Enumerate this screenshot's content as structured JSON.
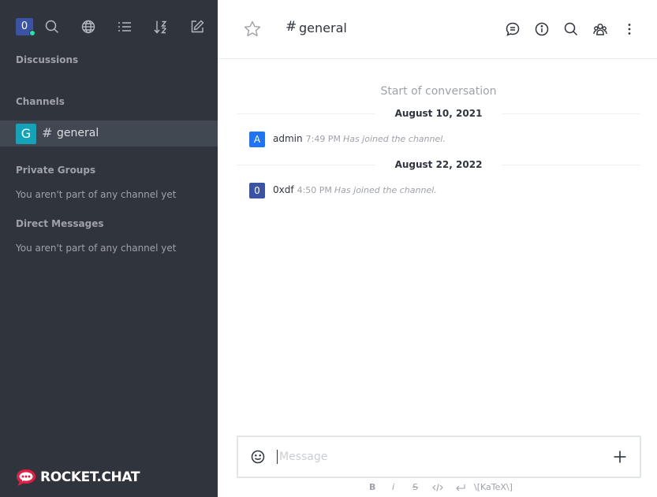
{
  "sidebar": {
    "user_avatar": "0",
    "toolbar": [
      "search-icon",
      "globe-icon",
      "list-icon",
      "sort-icon",
      "edit-icon"
    ],
    "sections": {
      "discussions": "Discussions",
      "channels": "Channels",
      "private_groups": "Private Groups",
      "direct_messages": "Direct Messages"
    },
    "channel": {
      "avatar": "G",
      "hash": "#",
      "name": "general"
    },
    "private_groups_note": "You aren't part of any channel yet",
    "direct_messages_note": "You aren't part of any channel yet",
    "logo_text": "ROCKET.CHAT"
  },
  "header": {
    "hash": "#",
    "title": "general",
    "actions": [
      "discussion-icon",
      "info-icon",
      "search-icon",
      "members-icon",
      "kebab-menu-icon"
    ]
  },
  "conversation": {
    "start_label": "Start of conversation",
    "days": [
      {
        "date": "August 10, 2021",
        "messages": [
          {
            "avatar": "A",
            "user": "admin",
            "time": "7:49 PM",
            "text": "Has joined the channel."
          }
        ]
      },
      {
        "date": "August 22, 2022",
        "messages": [
          {
            "avatar": "0",
            "user": "0xdf",
            "time": "4:50 PM",
            "text": "Has joined the channel."
          }
        ]
      }
    ]
  },
  "composer": {
    "placeholder": "Message",
    "formatting": {
      "bold": "B",
      "italic": "i",
      "strike": "S",
      "katex": "\\[KaTeX\\]"
    }
  },
  "colors": {
    "sidebar_bg": "#2f343d",
    "sidebar_active": "#414852",
    "user_avatar": "#3a53a4",
    "channel_avatar": "#12a3b8",
    "admin_avatar": "#1d74f5",
    "online_status": "#2de0a5",
    "logo_red": "#e01e43"
  }
}
